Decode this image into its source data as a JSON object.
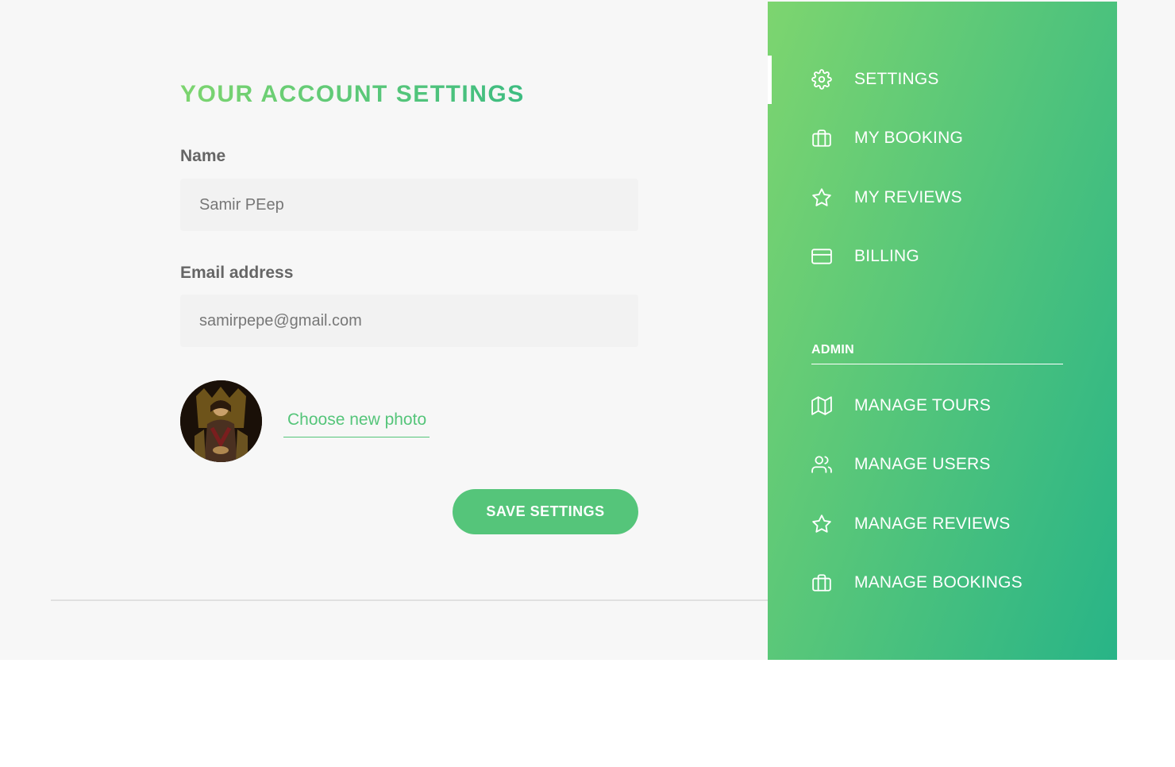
{
  "page": {
    "title": "YOUR ACCOUNT SETTINGS"
  },
  "form": {
    "name": {
      "label": "Name",
      "value": "Samir PEep"
    },
    "email": {
      "label": "Email address",
      "value": "samirpepe@gmail.com"
    },
    "photo": {
      "choose_label": "Choose new photo"
    },
    "save_label": "SAVE SETTINGS"
  },
  "sidebar": {
    "items": [
      {
        "label": "SETTINGS",
        "icon": "settings-icon",
        "active": true
      },
      {
        "label": "MY BOOKING",
        "icon": "briefcase-icon"
      },
      {
        "label": "MY REVIEWS",
        "icon": "star-icon"
      },
      {
        "label": "BILLING",
        "icon": "credit-card-icon"
      }
    ],
    "admin": {
      "heading": "ADMIN",
      "items": [
        {
          "label": "MANAGE TOURS",
          "icon": "map-icon"
        },
        {
          "label": "MANAGE USERS",
          "icon": "users-icon"
        },
        {
          "label": "MANAGE REVIEWS",
          "icon": "star-icon"
        },
        {
          "label": "MANAGE BOOKINGS",
          "icon": "briefcase-icon"
        }
      ]
    }
  },
  "colors": {
    "accent": "#55c57a",
    "gradient_start": "#7dd56f",
    "gradient_end": "#28b487",
    "background": "#f7f7f7",
    "input_bg": "#f2f2f2"
  }
}
